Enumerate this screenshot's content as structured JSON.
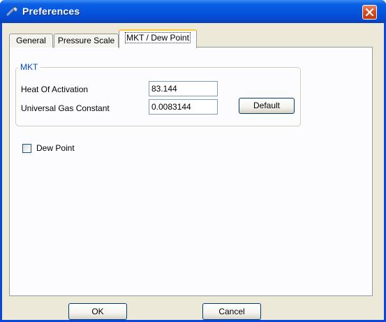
{
  "window": {
    "title": "Preferences"
  },
  "icons": {
    "app": "wrench-icon",
    "close": "close-icon"
  },
  "tabs": [
    {
      "label": "General",
      "active": false
    },
    {
      "label": "Pressure Scale",
      "active": false
    },
    {
      "label": "MKT / Dew Point",
      "active": true
    }
  ],
  "mkt": {
    "group_label": "MKT",
    "heat_label": "Heat Of Activation",
    "heat_value": "83.144",
    "gas_label": "Universal Gas Constant",
    "gas_value": "0.0083144",
    "default_label": "Default"
  },
  "dew_point": {
    "label": "Dew Point",
    "checked": false
  },
  "buttons": {
    "ok": "OK",
    "cancel": "Cancel"
  },
  "colors": {
    "titlebar": "#0554DC",
    "group_label": "#0046D5",
    "close": "#D8491F",
    "tab_highlight": "#FFC83C"
  }
}
